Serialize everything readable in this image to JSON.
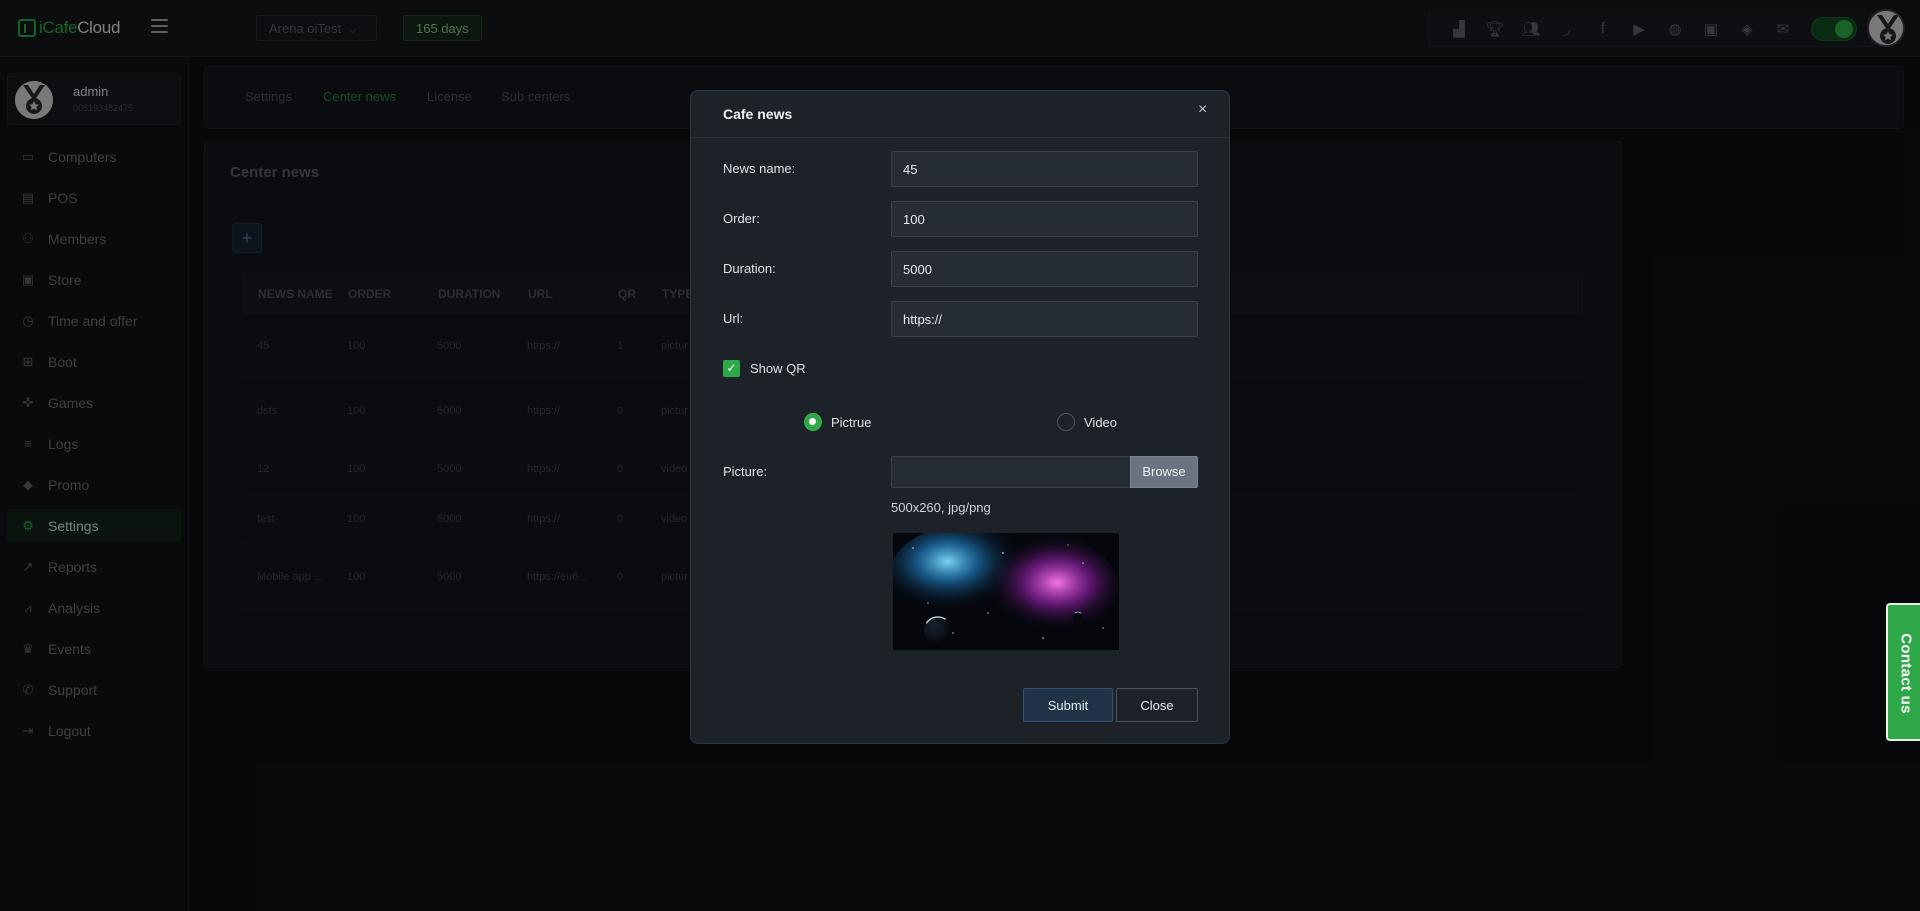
{
  "app": {
    "logo_prefix": "iCafe",
    "logo_suffix": "Cloud",
    "center_select": "Arena oiTest",
    "days_badge": "165 days",
    "top_icons": [
      "leaderboard-icon",
      "trophy-icon",
      "users-icon",
      "rss-icon",
      "facebook-icon",
      "youtube-icon",
      "globe-icon",
      "news-icon",
      "eye-off-icon",
      "mail-icon"
    ],
    "accent": "#2fb34a"
  },
  "sidebar": {
    "user": {
      "name": "admin",
      "id": "005193482475"
    },
    "items": [
      {
        "label": "Computers",
        "icon": "monitor-icon"
      },
      {
        "label": "POS",
        "icon": "cash-register-icon"
      },
      {
        "label": "Members",
        "icon": "members-icon"
      },
      {
        "label": "Store",
        "icon": "bag-icon"
      },
      {
        "label": "Time and offer",
        "icon": "clock-icon"
      },
      {
        "label": "Boot",
        "icon": "windows-icon"
      },
      {
        "label": "Games",
        "icon": "gamepad-icon"
      },
      {
        "label": "Logs",
        "icon": "list-icon"
      },
      {
        "label": "Promo",
        "icon": "tag-icon"
      },
      {
        "label": "Settings",
        "icon": "gear-icon",
        "active": true
      },
      {
        "label": "Reports",
        "icon": "line-chart-icon"
      },
      {
        "label": "Analysis",
        "icon": "analysis-icon"
      },
      {
        "label": "Events",
        "icon": "crown-icon"
      },
      {
        "label": "Support",
        "icon": "phone-icon"
      },
      {
        "label": "Logout",
        "icon": "logout-icon"
      }
    ]
  },
  "tabs": [
    {
      "label": "Settings"
    },
    {
      "label": "Center news",
      "active": true
    },
    {
      "label": "License"
    },
    {
      "label": "Sub centers"
    }
  ],
  "panel": {
    "title": "Center news",
    "add_label": "+",
    "columns": [
      "NEWS NAME",
      "ORDER",
      "DURATION",
      "URL",
      "QR",
      "TYPE"
    ],
    "rows": [
      [
        "45",
        "100",
        "5000",
        "https://",
        "1",
        "pictur"
      ],
      [
        "dsfs",
        "100",
        "5000",
        "https://",
        "0",
        "pictur"
      ],
      [
        "12",
        "100",
        "5000",
        "https://",
        "0",
        "video"
      ],
      [
        "test",
        "100",
        "5000",
        "https://",
        "0",
        "video"
      ],
      [
        "Mobile app ...",
        "100",
        "5000",
        "https://eu6...",
        "0",
        "pictur"
      ]
    ]
  },
  "modal": {
    "title": "Cafe news",
    "close_x": "×",
    "news_name_label": "News name:",
    "news_name_value": "45",
    "order_label": "Order:",
    "order_value": "100",
    "duration_label": "Duration:",
    "duration_value": "5000",
    "url_label": "Url:",
    "url_value": "https://",
    "show_qr_label": "Show QR",
    "show_qr_checked": true,
    "radio_picture": "Pictrue",
    "radio_video": "Video",
    "radio_selected": "picture",
    "picture_label": "Picture:",
    "browse_label": "Browse",
    "hint": "500x260, jpg/png",
    "submit_label": "Submit",
    "close_label": "Close"
  },
  "contact": {
    "label": "Contact us"
  }
}
